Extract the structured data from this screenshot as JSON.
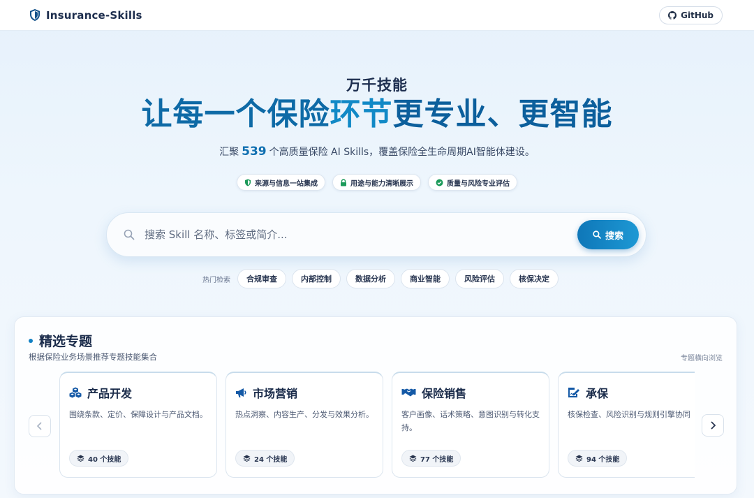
{
  "header": {
    "brand": "Insurance-Skills",
    "github_label": "GitHub"
  },
  "hero": {
    "eyebrow": "万千技能",
    "title_part1": "让每一个保险",
    "title_part2": "环节",
    "title_part3": "更专业、更智能",
    "subtitle_prefix": "汇聚",
    "skill_count": "539",
    "subtitle_suffix": "个高质量保险 AI Skills，覆盖保险全生命周期AI智能体建设。",
    "badges": [
      {
        "label": "来源与信息一站集成",
        "icon": "shield-icon"
      },
      {
        "label": "用途与能力清晰展示",
        "icon": "lock-icon"
      },
      {
        "label": "质量与风险专业评估",
        "icon": "check-circle-icon"
      }
    ]
  },
  "search": {
    "placeholder": "搜索 Skill 名称、标签或简介...",
    "button_label": "搜索",
    "hot_label": "热门检索",
    "hot_tags": [
      "合规审查",
      "内部控制",
      "数据分析",
      "商业智能",
      "风险评估",
      "核保决定"
    ]
  },
  "featured": {
    "title": "精选专题",
    "subtitle": "根据保险业务场景推荐专题技能集合",
    "hint": "专题横向浏览",
    "cards": [
      {
        "title": "产品开发",
        "desc": "围绕条款、定价、保障设计与产品文档。",
        "count": "40 个技能",
        "icon": "cubes-icon"
      },
      {
        "title": "市场营销",
        "desc": "热点洞察、内容生产、分发与效果分析。",
        "count": "24 个技能",
        "icon": "megaphone-icon"
      },
      {
        "title": "保险销售",
        "desc": "客户画像、话术策略、意图识别与转化支持。",
        "count": "77 个技能",
        "icon": "handshake-icon"
      },
      {
        "title": "承保",
        "desc": "核保检查、风险识别与规则引擎协同",
        "count": "94 个技能",
        "icon": "signature-icon"
      }
    ]
  },
  "colors": {
    "accent": "#0f77b8",
    "title_blue": "#0e6aa6",
    "title_light_blue": "#1189c6"
  }
}
